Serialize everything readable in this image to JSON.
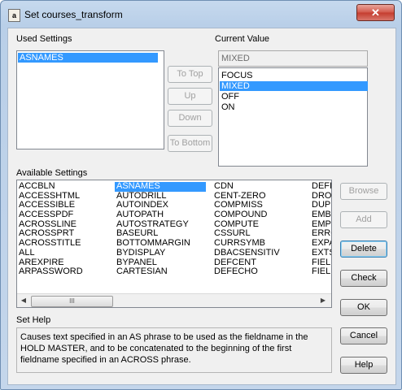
{
  "window": {
    "title": "Set courses_transform",
    "close_glyph": "✕",
    "icon_glyph": "a"
  },
  "used_settings": {
    "label": "Used Settings",
    "items": [
      "ASNAMES"
    ],
    "selected": "ASNAMES"
  },
  "move_buttons": {
    "to_top": "To Top",
    "up": "Up",
    "down": "Down",
    "to_bottom": "To Bottom"
  },
  "current_value": {
    "label": "Current Value",
    "value": "MIXED",
    "options": [
      "FOCUS",
      "MIXED",
      "OFF",
      "ON"
    ],
    "selected": "MIXED"
  },
  "available_settings": {
    "label": "Available Settings",
    "columns": [
      [
        "ACCBLN",
        "ACCESSHTML",
        "ACCESSIBLE",
        "ACCESSPDF",
        "ACROSSLINE",
        "ACROSSPRT",
        "ACROSSTITLE",
        "ALL",
        "AREXPIRE",
        "ARPASSWORD"
      ],
      [
        "ASNAMES",
        "AUTODRILL",
        "AUTOINDEX",
        "AUTOPATH",
        "AUTOSTRATEGY",
        "BASEURL",
        "BOTTOMMARGIN",
        "BYDISPLAY",
        "BYPANEL",
        "CARTESIAN"
      ],
      [
        "CDN",
        "CENT-ZERO",
        "COMPMISS",
        "COMPOUND",
        "COMPUTE",
        "CSSURL",
        "CURRSYMB",
        "DBACSENSITIV",
        "DEFCENT",
        "DEFECHO"
      ],
      [
        "DEFI",
        "DRO",
        "DUPL",
        "EMBE",
        "EMPT",
        "ERRO",
        "EXPA",
        "EXTS",
        "FIEL",
        "FIEL"
      ]
    ],
    "selected": "ASNAMES",
    "scroll_left": "◀",
    "scroll_right": "▶",
    "thumb_grip": "III"
  },
  "side_buttons": {
    "browse": "Browse",
    "add": "Add",
    "delete": "Delete",
    "check": "Check",
    "ok": "OK",
    "cancel": "Cancel",
    "help": "Help"
  },
  "set_help": {
    "label": "Set Help",
    "text": "Causes text specified in an AS phrase to be used as the fieldname in the HOLD MASTER, and to be concatenated to the beginning of the first fieldname specified in an ACROSS phrase."
  }
}
